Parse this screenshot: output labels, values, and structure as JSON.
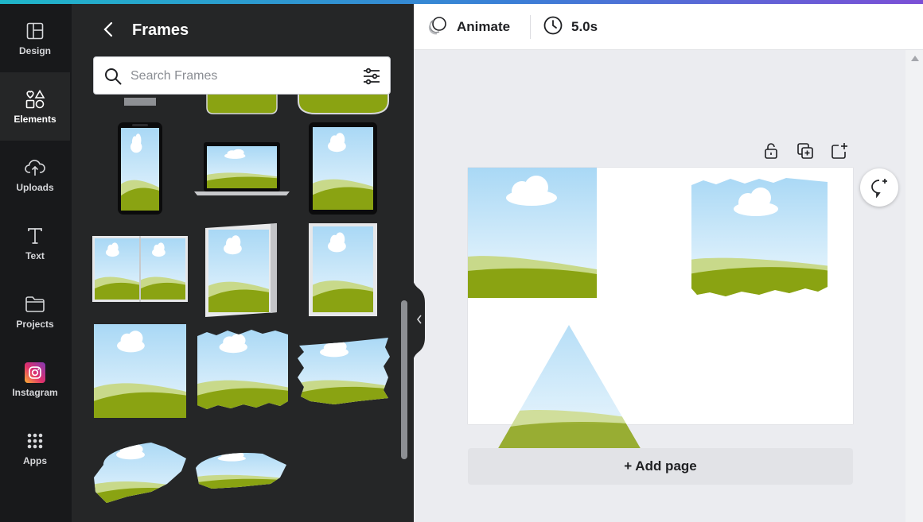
{
  "rail": {
    "items": [
      {
        "label": "Design",
        "icon": "layout-icon"
      },
      {
        "label": "Elements",
        "icon": "shapes-icon"
      },
      {
        "label": "Uploads",
        "icon": "cloud-upload-icon"
      },
      {
        "label": "Text",
        "icon": "text-icon"
      },
      {
        "label": "Projects",
        "icon": "folder-icon"
      },
      {
        "label": "Instagram",
        "icon": "instagram-icon"
      },
      {
        "label": "Apps",
        "icon": "apps-grid-icon"
      }
    ]
  },
  "panel": {
    "title": "Frames",
    "search_placeholder": "Search Frames"
  },
  "toolbar": {
    "animate_label": "Animate",
    "duration_label": "5.0s"
  },
  "editor": {
    "add_page_label": "+ Add page"
  },
  "colors": {
    "sky": "#bfe3f7",
    "grass_light": "#c8d98a",
    "grass_dark": "#8aa312",
    "rail_bg": "#18191b",
    "panel_bg": "#252627"
  }
}
